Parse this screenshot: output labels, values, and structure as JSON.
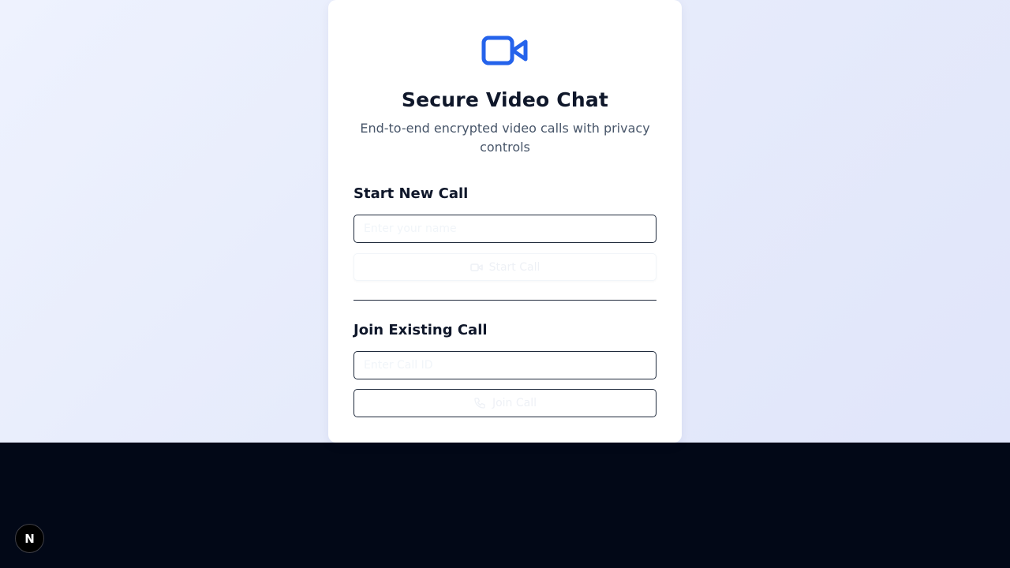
{
  "header": {
    "logo_icon": "video-camera-icon",
    "title": "Secure Video Chat",
    "subtitle": "End-to-end encrypted video calls with privacy controls"
  },
  "start_call": {
    "heading": "Start New Call",
    "input_placeholder": "Enter your name",
    "button_label": "Start Call",
    "button_icon": "video-icon"
  },
  "join_call": {
    "heading": "Join Existing Call",
    "input_placeholder": "Enter Call ID",
    "button_label": "Join Call",
    "button_icon": "phone-icon"
  },
  "dev_badge": {
    "label": "N",
    "icon": "nextjs-logo-icon"
  },
  "colors": {
    "accent": "#2563eb",
    "text_primary": "#0f172a",
    "text_muted": "#475569",
    "footer_bg": "#020817"
  }
}
